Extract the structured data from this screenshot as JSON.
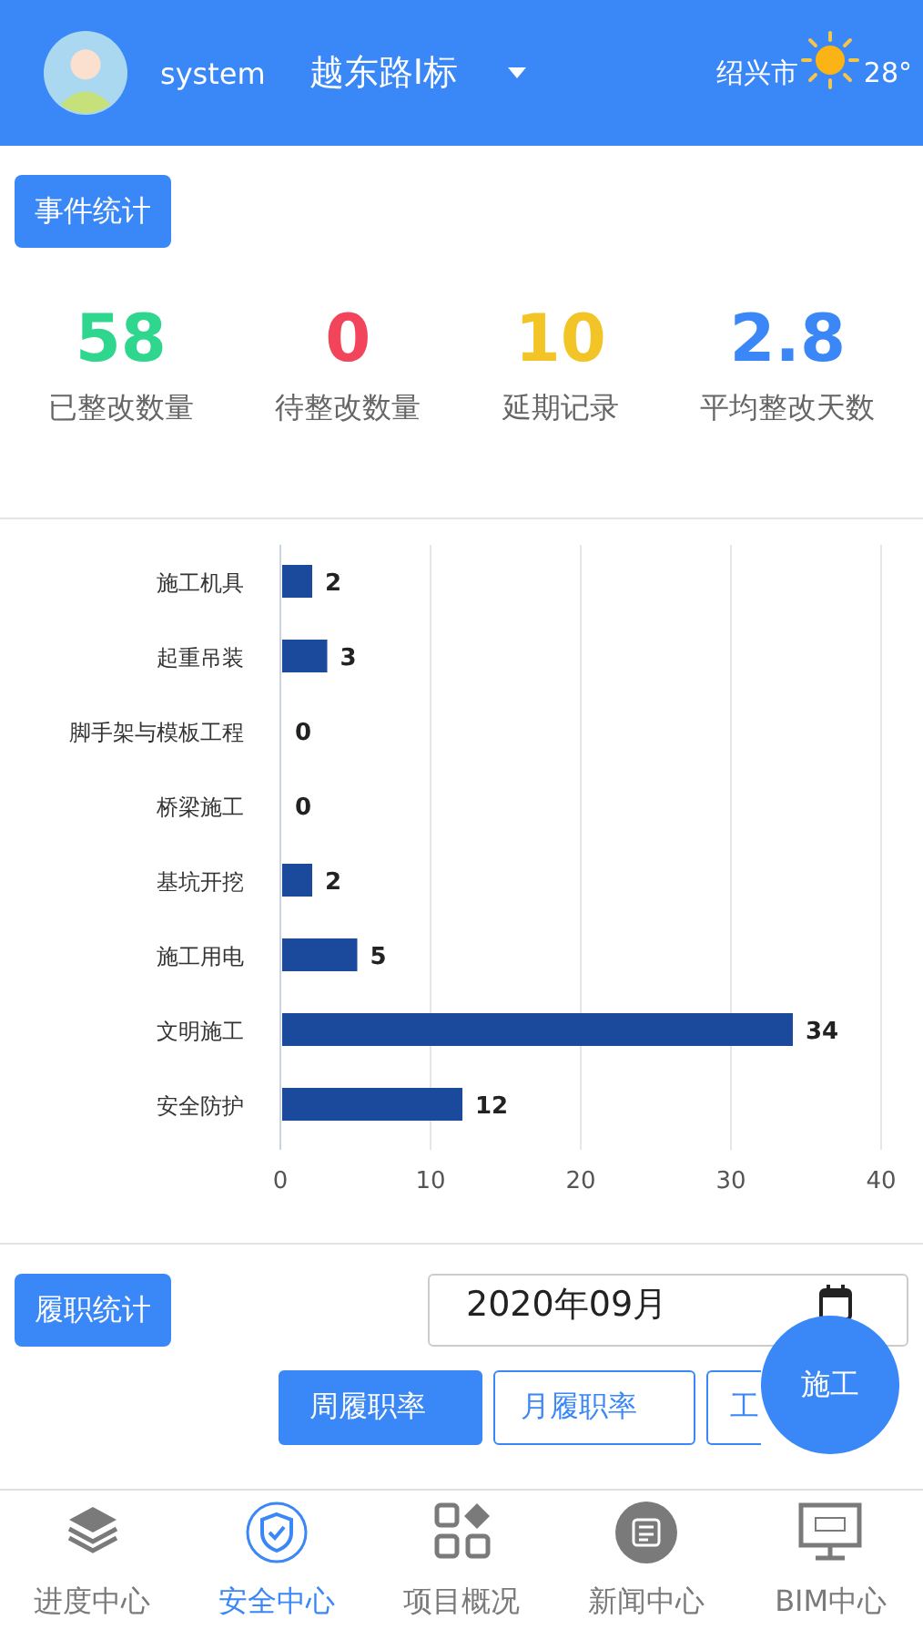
{
  "header": {
    "user": "system",
    "project": "越东路Ⅰ标",
    "city": "绍兴市",
    "temperature": "28°"
  },
  "event_section": {
    "button": "事件统计",
    "stats": [
      {
        "value": "58",
        "label": "已整改数量",
        "color": "#2fd68e"
      },
      {
        "value": "0",
        "label": "待整改数量",
        "color": "#f2455b"
      },
      {
        "value": "10",
        "label": "延期记录",
        "color": "#f3c425"
      },
      {
        "value": "2.8",
        "label": "平均整改天数",
        "color": "#3b87f7"
      }
    ],
    "chart_data": {
      "type": "bar",
      "orientation": "horizontal",
      "categories": [
        "施工机具",
        "起重吊装",
        "脚手架与模板工程",
        "桥梁施工",
        "基坑开挖",
        "施工用电",
        "文明施工",
        "安全防护"
      ],
      "values": [
        2,
        3,
        0,
        0,
        2,
        5,
        34,
        12
      ],
      "xlim": [
        0,
        40
      ],
      "xticks": [
        0,
        10,
        20,
        30,
        40
      ],
      "grid": true,
      "data_labels": true
    }
  },
  "duty_section": {
    "button": "履职统计",
    "date": "2020年09月",
    "tabs": [
      {
        "label": "周履职率",
        "selected": true
      },
      {
        "label": "月履职率",
        "selected": false
      },
      {
        "label": "工",
        "selected": false
      }
    ],
    "floating_button": "施工"
  },
  "nav": [
    {
      "label": "进度中心",
      "kind": "layers",
      "selected": false
    },
    {
      "label": "安全中心",
      "kind": "shield",
      "selected": true
    },
    {
      "label": "项目概况",
      "kind": "grid",
      "selected": false
    },
    {
      "label": "新闻中心",
      "kind": "news",
      "selected": false
    },
    {
      "label": "BIM中心",
      "kind": "monitor",
      "selected": false
    }
  ]
}
